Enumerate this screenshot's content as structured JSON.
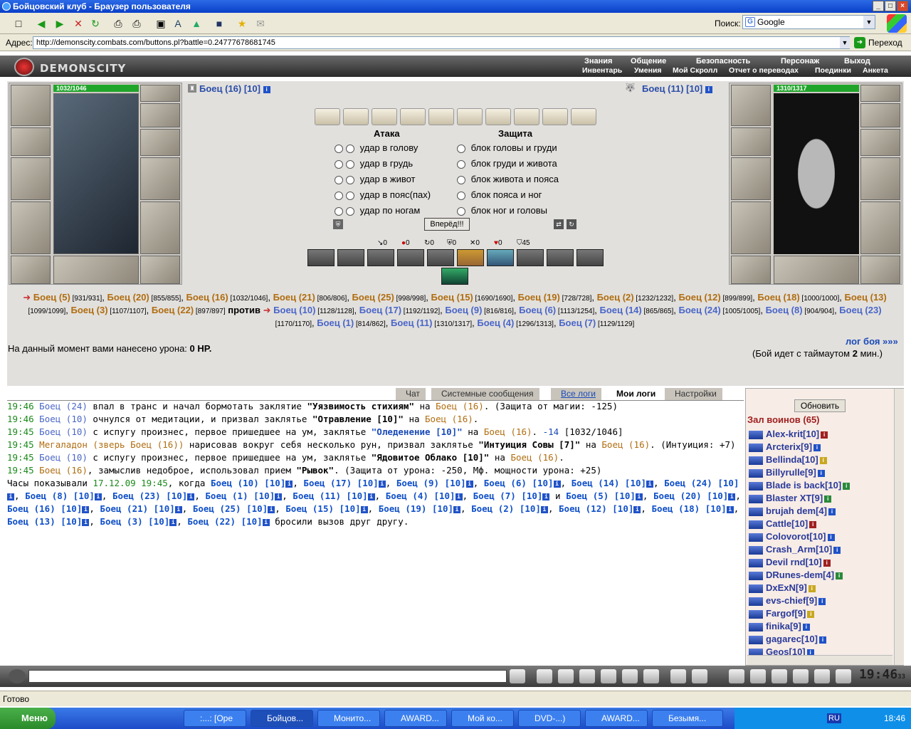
{
  "window": {
    "title": "Бойцовский клуб - Браузер пользователя"
  },
  "browser": {
    "address_label": "Адрес:",
    "url": "http://demonscity.combats.com/buttons.pl?battle=0.24777678681745",
    "go_label": "Переход",
    "search_label": "Поиск:",
    "search_engine": "Google"
  },
  "game": {
    "logo": "DEMONSCITY",
    "nav_top": [
      "Знания",
      "Общение",
      "Безопасность",
      "Персонаж",
      "Выход"
    ],
    "nav_bottom": [
      "Инвентарь",
      "Умения",
      "Мой Скролл",
      "Отчет о переводах",
      "Поединки",
      "Анкета"
    ]
  },
  "battle": {
    "left": {
      "name": "Боец (16) [10]",
      "hp": "1032/1046"
    },
    "right": {
      "name": "Боец (11) [10]",
      "hp": "1310/1317"
    },
    "attack_header": "Атака",
    "defense_header": "Защита",
    "attacks": [
      "удар в голову",
      "удар в грудь",
      "удар в живот",
      "удар в пояс(пах)",
      "удар по ногам"
    ],
    "blocks": [
      "блок головы и груди",
      "блок груди и живота",
      "блок живота и пояса",
      "блок пояса и ног",
      "блок ног и головы"
    ],
    "go_button": "Вперёд!!!",
    "stats": [
      "0",
      "0",
      "0",
      "0",
      "0",
      "0",
      "45"
    ],
    "team1": [
      [
        "Боец (5)",
        "[931/931]"
      ],
      [
        "Боец (20)",
        "[855/855]"
      ],
      [
        "Боец (16)",
        "[1032/1046]"
      ],
      [
        "Боец (21)",
        "[806/806]"
      ],
      [
        "Боец (25)",
        "[998/998]"
      ],
      [
        "Боец (15)",
        "[1690/1690]"
      ],
      [
        "Боец (19)",
        "[728/728]"
      ],
      [
        "Боец (2)",
        "[1232/1232]"
      ],
      [
        "Боец (12)",
        "[899/899]"
      ],
      [
        "Боец (18)",
        "[1000/1000]"
      ],
      [
        "Боец (13)",
        "[1099/1099]"
      ],
      [
        "Боец (3)",
        "[1107/1107]"
      ],
      [
        "Боец (22)",
        "[897/897]"
      ]
    ],
    "versus": "против",
    "team2": [
      [
        "Боец (10)",
        "[1128/1128]"
      ],
      [
        "Боец (17)",
        "[1192/1192]"
      ],
      [
        "Боец (9)",
        "[816/816]"
      ],
      [
        "Боец (6)",
        "[1113/1254]"
      ],
      [
        "Боец (14)",
        "[865/865]"
      ],
      [
        "Боец (24)",
        "[1005/1005]"
      ],
      [
        "Боец (8)",
        "[904/904]"
      ],
      [
        "Боец (23)",
        "[1170/1170]"
      ],
      [
        "Боец (1)",
        "[814/862]"
      ],
      [
        "Боец (11)",
        "[1310/1317]"
      ],
      [
        "Боец (4)",
        "[1296/1313]"
      ],
      [
        "Боец (7)",
        "[1129/1129]"
      ]
    ],
    "damage_prefix": "На данный момент вами нанесено урона:",
    "damage_value": "0 HP.",
    "log_link": "лог боя »»»",
    "timeout_prefix": "(Бой идет с таймаутом",
    "timeout_value": "2",
    "timeout_suffix": "мин.)"
  },
  "tabs": [
    "Чат",
    "Системные сообщения",
    "Все логи",
    "Мои логи",
    "Настройки"
  ],
  "log": {
    "l1": {
      "time": "19:46",
      "who": "Боец (24)",
      "t1": " впал в транс и начал бормотать заклятие ",
      "spell": "\"Уязвимость стихиям\"",
      "t2": " на ",
      "target": "Боец (16)",
      "t3": ". (Защита от магии: -125)"
    },
    "l2": {
      "time": "19:46",
      "who": "Боец (10)",
      "t1": " очнулся от медитации, и призвал заклятье ",
      "spell": "\"Отравление [10]\"",
      "t2": " на ",
      "target": "Боец (16)",
      "t3": "."
    },
    "l3": {
      "time": "19:45",
      "who": "Боец (10)",
      "t1": " с испугу произнес, первое пришедшее на ум, заклятье ",
      "spell": "\"Оледенение [10]\"",
      "t2": " на ",
      "target": "Боец (16)",
      "t3": ". ",
      "dmg": "-14",
      "hp": " [1032/1046]"
    },
    "l4": {
      "time": "19:45",
      "who": "Мегаладон (зверь Боец (16))",
      "t1": " нарисовав вокруг себя несколько рун, призвал заклятье ",
      "spell": "\"Интуиция Совы [7]\"",
      "t2": " на ",
      "target": "Боец (16)",
      "t3": ". (Интуиция: +7)"
    },
    "l5": {
      "time": "19:45",
      "who": "Боец (10)",
      "t1": " с испугу произнес, первое пришедшее на ум, заклятье ",
      "spell": "\"Ядовитое Облако [10]\"",
      "t2": " на ",
      "target": "Боец (16)",
      "t3": "."
    },
    "l6": {
      "time": "19:45",
      "who": "Боец (16)",
      "t1": ", замыслив недоброе, использовал прием ",
      "spell": "\"Рывок\"",
      "t2": ". (Защита от урона: -250, Мф. мощности урона: +25)"
    },
    "l7_prefix": "Часы показывали ",
    "l7_time": "17.12.09 19:45",
    "l7_when": ", когда",
    "fighters": [
      "Боец (10) [10]",
      "Боец (17) [10]",
      "Боец (9) [10]",
      "Боец (6) [10]",
      "Боец (14) [10]",
      "Боец (24) [10]",
      "Боец (8) [10]",
      "Боец (23) [10]",
      "Боец (1) [10]",
      "Боец (11) [10]",
      "Боец (4) [10]",
      "Боец (7) [10]"
    ],
    "and_word": "и",
    "fighters2": [
      "Боец (5) [10]",
      "Боец (20) [10]",
      "Боец (16) [10]",
      "Боец (21) [10]",
      "Боец (25) [10]",
      "Боец (15) [10]",
      "Боец (19) [10]",
      "Боец (2) [10]",
      "Боец (12) [10]",
      "Боец (18) [10]",
      "Боец (13) [10]",
      "Боец (3) [10]",
      "Боец (22) [10]"
    ],
    "l7_end": " бросили вызов друг другу."
  },
  "players": {
    "refresh": "Обновить",
    "room": "Зал воинов (65)",
    "list": [
      "Alex-krit[10]",
      "Arcterix[9]",
      "Bellinda[10]",
      "Billyrulle[9]",
      "Blade is back[10]",
      "Blaster XT[9]",
      "brujah dem[4]",
      "Cattle[10]",
      "Colovorot[10]",
      "Crash_Arm[10]",
      "Devil rnd[10]",
      "DRunes-dem[4]",
      "DxExN[9]",
      "evs-chief[9]",
      "Fargof[9]",
      "finika[9]",
      "gagarec[10]",
      "Geos[10]"
    ]
  },
  "clock": {
    "time": "19:46",
    "sec": "33"
  },
  "status": "Готово",
  "taskbar": {
    "start": "Меню",
    "tasks": [
      ":...: [Ope",
      "Бойцов...",
      "Монито...",
      "AWARD...",
      "Мой ко...",
      "DVD-...)",
      "AWARD...",
      "Безымя..."
    ],
    "lang": "RU",
    "time": "18:46"
  }
}
